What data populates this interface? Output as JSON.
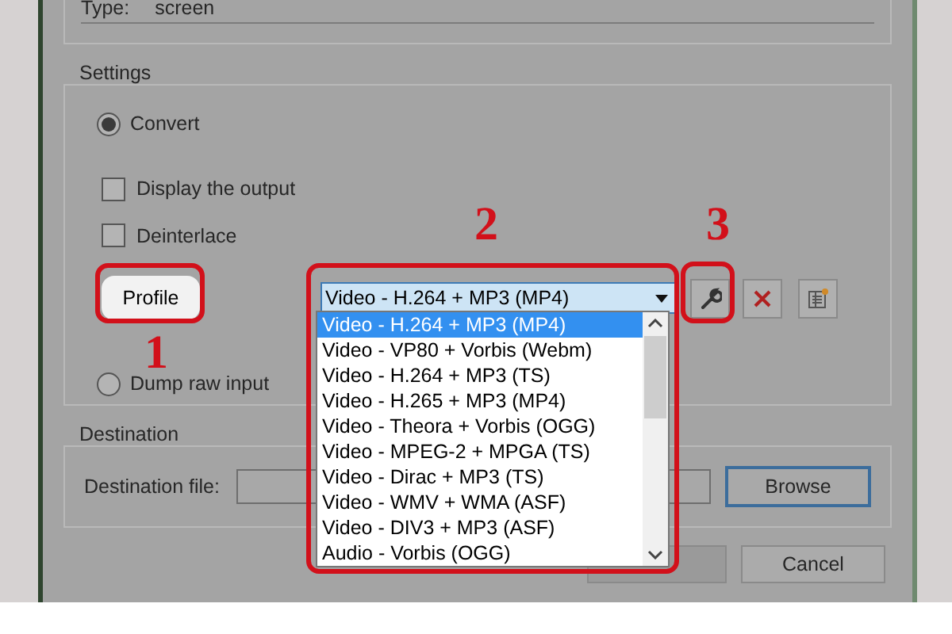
{
  "source": {
    "type_label": "Type:",
    "type_value": "screen"
  },
  "settings": {
    "title": "Settings",
    "modes": [
      {
        "label": "Convert",
        "selected": true
      },
      {
        "label": "Dump raw input",
        "selected": false
      }
    ],
    "options": [
      {
        "label": "Display the output",
        "checked": false
      },
      {
        "label": "Deinterlace",
        "checked": false
      }
    ],
    "profile_label": "Profile",
    "profile_value": "Video - H.264 + MP3 (MP4)",
    "profiles": [
      {
        "label": "Video - H.264 + MP3 (MP4)",
        "selected": true
      },
      {
        "label": "Video - VP80 + Vorbis (Webm)",
        "selected": false
      },
      {
        "label": "Video - H.264 + MP3 (TS)",
        "selected": false
      },
      {
        "label": "Video - H.265 + MP3 (MP4)",
        "selected": false
      },
      {
        "label": "Video - Theora + Vorbis (OGG)",
        "selected": false
      },
      {
        "label": "Video - MPEG-2 + MPGA (TS)",
        "selected": false
      },
      {
        "label": "Video - Dirac + MP3 (TS)",
        "selected": false
      },
      {
        "label": "Video - WMV + WMA (ASF)",
        "selected": false
      },
      {
        "label": "Video - DIV3 + MP3 (ASF)",
        "selected": false
      },
      {
        "label": "Audio - Vorbis (OGG)",
        "selected": false
      }
    ]
  },
  "destination": {
    "title": "Destination",
    "file_label": "Destination file:",
    "browse": "Browse"
  },
  "buttons": [
    {
      "label": "Cancel"
    }
  ],
  "annotations": [
    {
      "label": "1"
    },
    {
      "label": "2"
    },
    {
      "label": "3"
    }
  ]
}
